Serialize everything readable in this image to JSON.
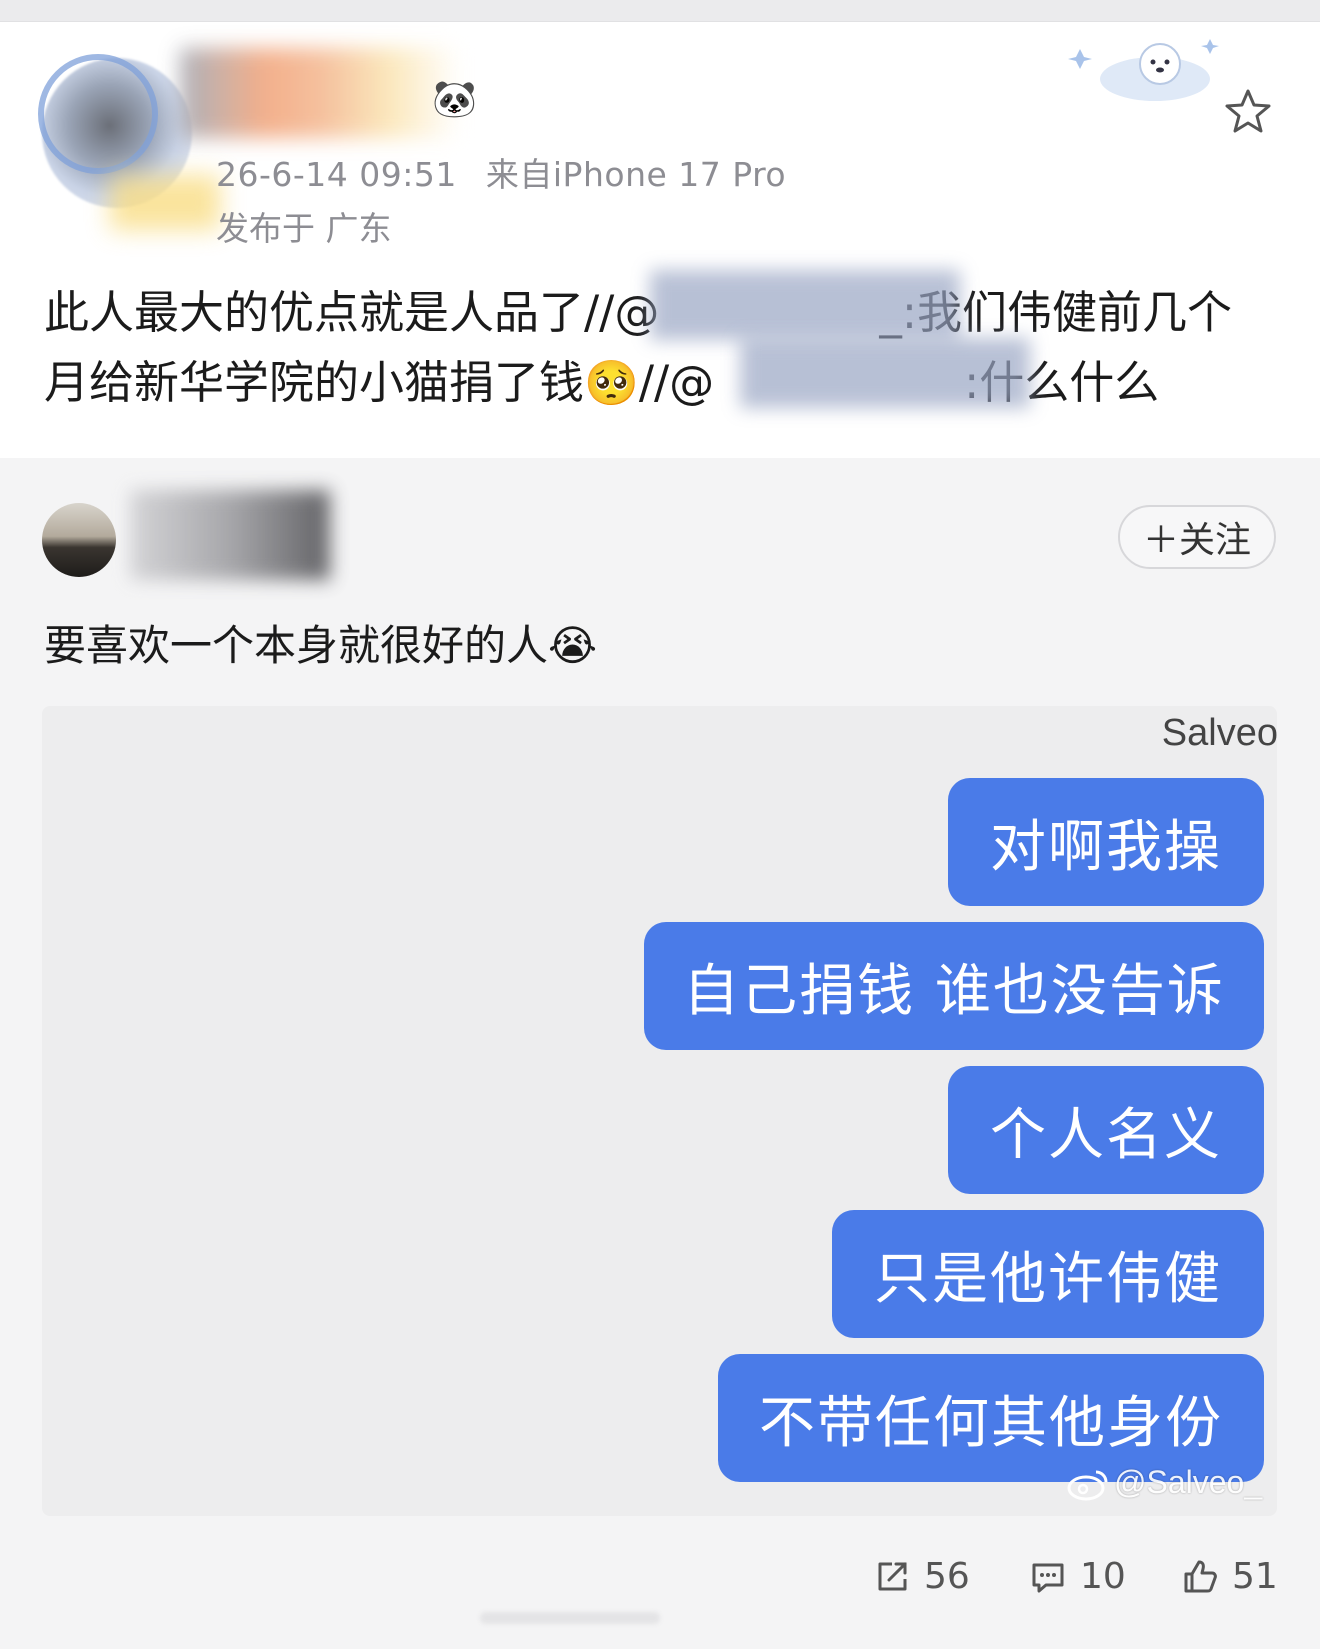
{
  "post": {
    "time": "26-6-14 09:51",
    "source_prefix": "来自",
    "source_device": "iPhone 17 Pro",
    "location": "发布于 广东",
    "text_line1_a": "此人最大的优点就是人品了//@",
    "text_line1_b": "_:我们伟健前几个",
    "text_line2_a": "月给新华学院的小猫捐了钱",
    "text_line2_b": "//@",
    "text_line2_c": ":什么什么"
  },
  "repost": {
    "follow_label": "＋关注",
    "text": "要喜欢一个本身就很好的人",
    "chat": {
      "contact_name": "Salveo",
      "bubbles": [
        "对啊我操",
        "自己捐钱 谁也没告诉",
        "个人名义",
        "只是他许伟健",
        "不带任何其他身份"
      ],
      "watermark": "@Salveo_"
    }
  },
  "actions": {
    "share_count": "56",
    "comment_count": "10",
    "like_count": "51"
  },
  "colors": {
    "bubble": "#4a7be8",
    "meta_text": "#8d8d93",
    "background": "#f4f4f5"
  },
  "icons": [
    "star-icon",
    "share-icon",
    "comment-icon",
    "like-icon",
    "weibo-logo-icon"
  ]
}
